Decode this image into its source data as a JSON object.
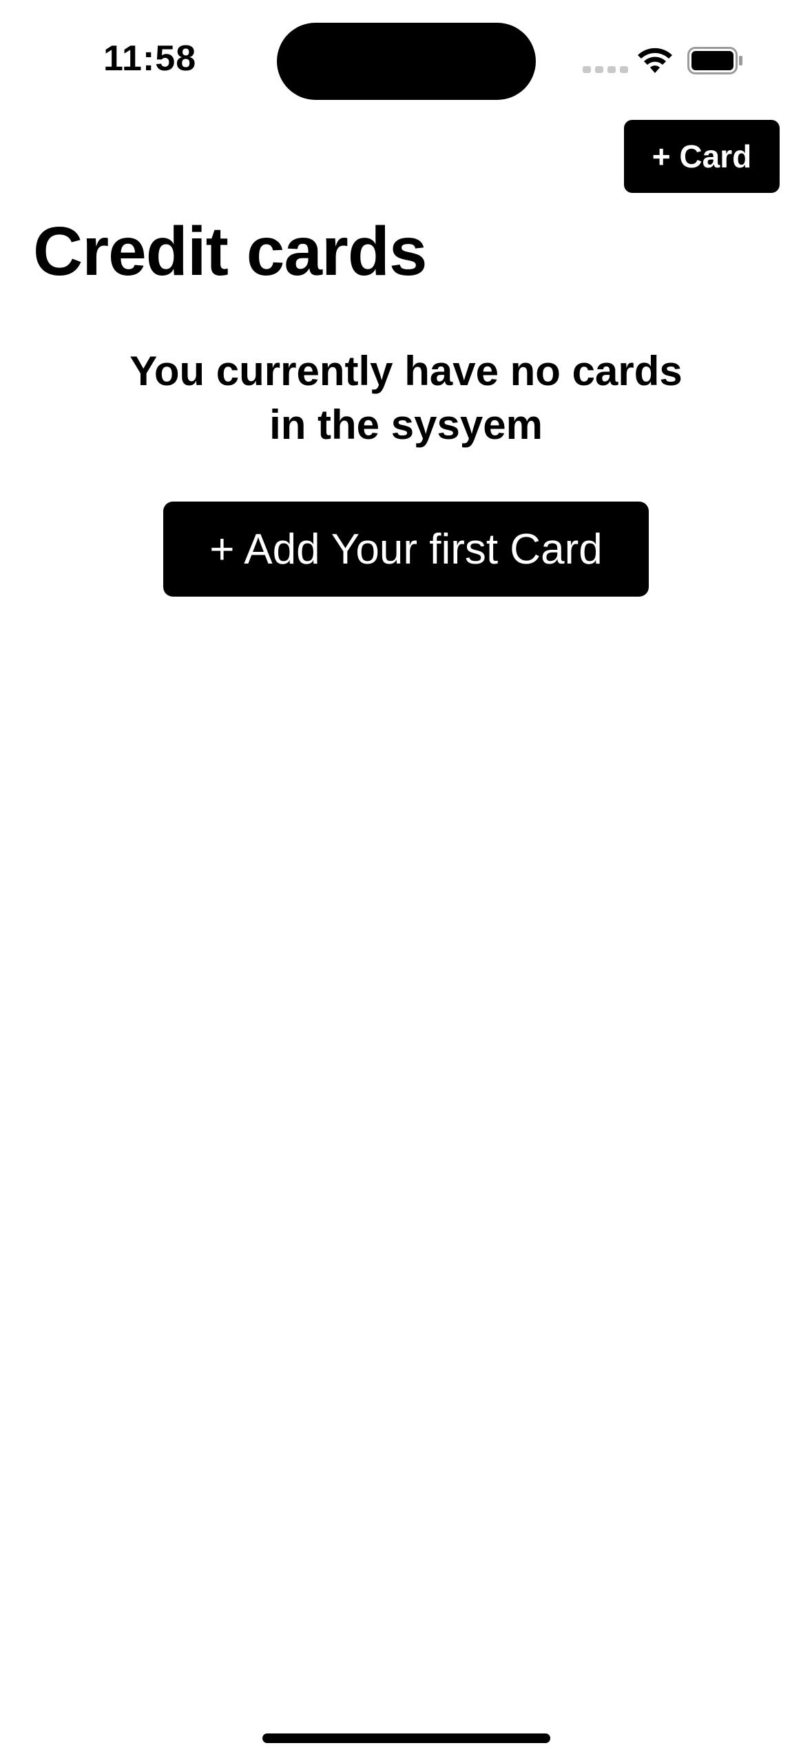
{
  "status_bar": {
    "time": "11:58",
    "signal_icon": "cellular-signal-icon",
    "wifi_icon": "wifi-icon",
    "battery_icon": "battery-icon"
  },
  "nav": {
    "add_card_label": "+ Card"
  },
  "header": {
    "title": "Credit cards"
  },
  "empty_state": {
    "message_line1": "You currently have no cards",
    "message_line2": "in the sysyem",
    "add_first_label": "+ Add Your first Card"
  },
  "colors": {
    "background": "#ffffff",
    "primary": "#000000",
    "button_text": "#ffffff",
    "signal_inactive": "#c8c8c8"
  }
}
